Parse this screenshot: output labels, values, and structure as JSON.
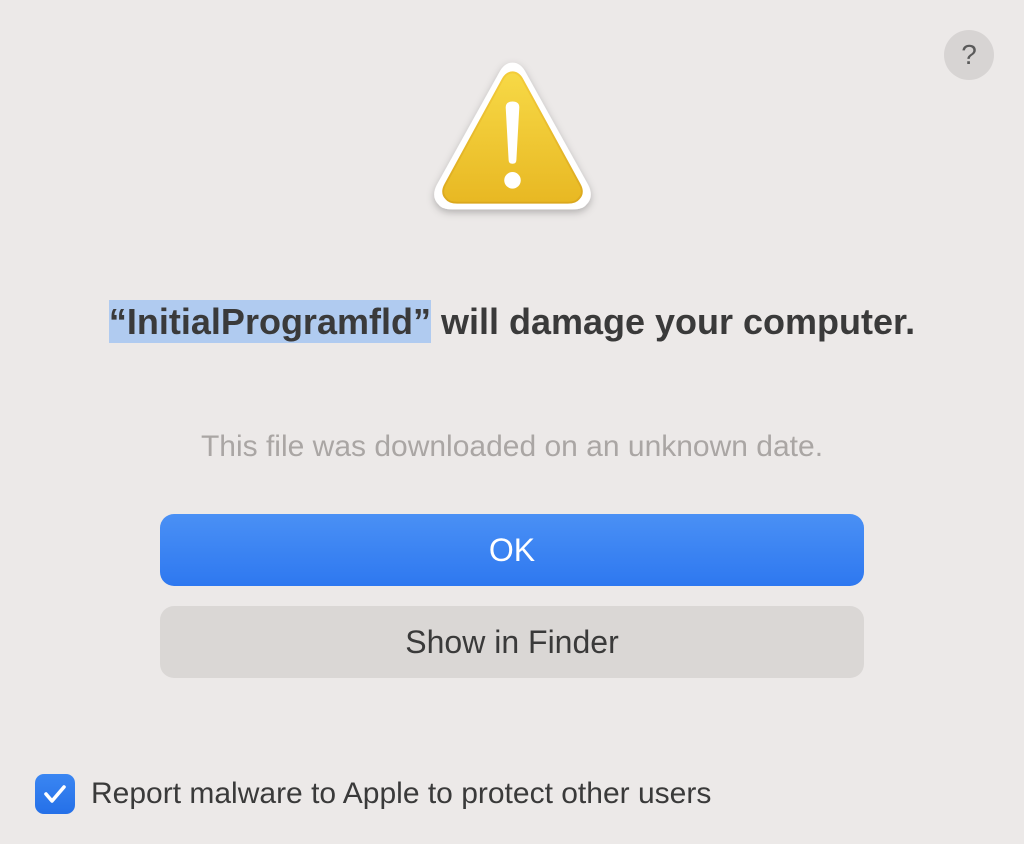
{
  "help": {
    "label": "?"
  },
  "title": {
    "highlighted": "“InitialProgramfld”",
    "rest": " will damage your computer."
  },
  "subtitle": "This file was downloaded on an unknown date.",
  "buttons": {
    "ok": "OK",
    "show_in_finder": "Show in Finder"
  },
  "checkbox": {
    "checked": true,
    "label": "Report malware to Apple to protect other users"
  }
}
